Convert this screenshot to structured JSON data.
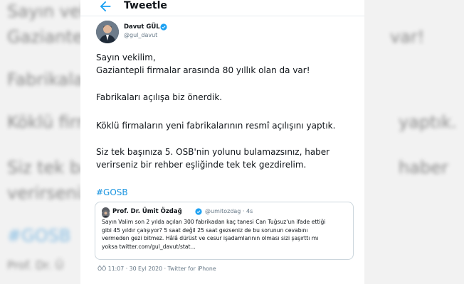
{
  "background_echo": {
    "line1": "Sayın vekil",
    "line2": "Gaziantepli",
    "line3": "Fabrikaları",
    "line4": "Köklü firma",
    "line5": "Siz tek başı",
    "line6": "verirseniz",
    "line7": "#GOSB",
    "line8": "Prof. Dr. Ü",
    "right1": "var!",
    "right2": "yaptık.",
    "right3": "haber"
  },
  "topbar": {
    "title": "Tweetle",
    "back_icon": "arrow-left-icon"
  },
  "author": {
    "name": "Davut GÜL",
    "handle": "@gul_davut",
    "verified_icon": "verified-badge-icon"
  },
  "tweet": {
    "para1_line1": "Sayın vekilim,",
    "para1_line2": "Gaziantepli firmalar arasında 80 yıllık olan da var!",
    "para2": "Fabrikaları açılışa biz önerdik.",
    "para3": "Köklü firmaların yeni fabrikalarının resmî açılışını yaptık.",
    "para4_line1": "Siz tek başınıza 5. OSB'nin yolunu bulamazsınız, haber",
    "para4_line2": "verirseniz bir rehber eşliğinde tek tek gezdirelim.",
    "hashtag": "#GOSB"
  },
  "quote": {
    "name": "Prof. Dr. Ümit Özdağ",
    "handle": "@umitozdag",
    "time": "4s",
    "lines": [
      "Sayın Valim son 2 yılda açılan 300 fabrikadan kaç tanesi Can Tuğsuz'un ifade ettiği",
      "gibi 45 yıldır çalışıyor? 5 saat değil 25 saat gezseniz de bu sorunun cevabını",
      "vermeden gezi bitmez. Hâlâ dürüst ve cesur işadamlarının olması sizi şaşırttı mı",
      "yoksa twitter.com/gul_davut/stat..."
    ]
  },
  "meta": {
    "text": "ÖÖ 11:07 · 30 Eyl 2020 · Twitter for iPhone"
  },
  "colors": {
    "link": "#1b95e0",
    "verified": "#1da1f2",
    "secondary_text": "#657786"
  }
}
